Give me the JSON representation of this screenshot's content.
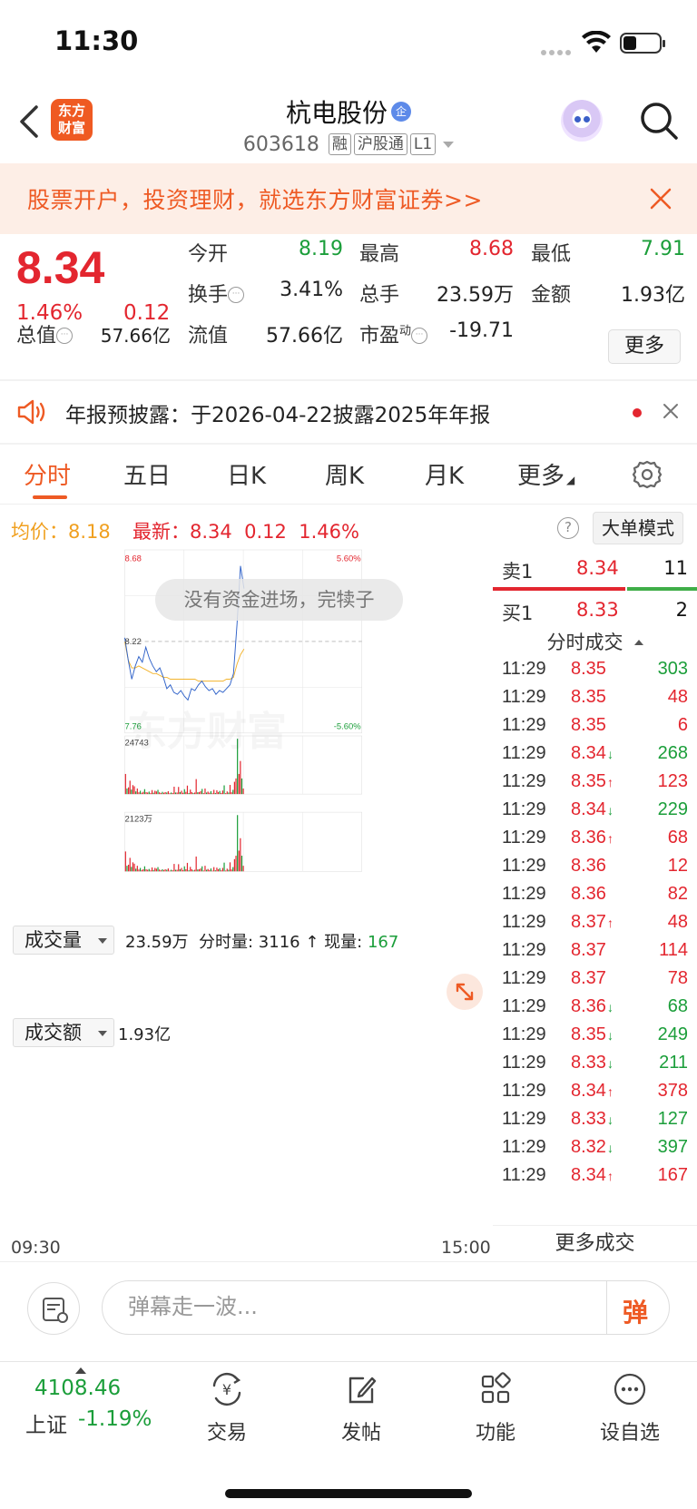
{
  "status_bar": {
    "time": "11:30"
  },
  "header": {
    "logo_text_1": "东方",
    "logo_text_2": "财富",
    "stock_name": "杭电股份",
    "enterprise_badge": "企",
    "stock_code": "603618",
    "tags": [
      "融",
      "沪股通",
      "L1"
    ]
  },
  "ad_banner": {
    "text": "股票开户，投资理财，就选东方财富证券>>"
  },
  "quote": {
    "last_price": "8.34",
    "change_pct": "1.46%",
    "change_amt": "0.12",
    "fields": [
      {
        "label": "今开",
        "value": "8.19",
        "color": "#1b9e3a"
      },
      {
        "label": "最高",
        "value": "8.68",
        "color": "#e3262f"
      },
      {
        "label": "最低",
        "value": "7.91",
        "color": "#1b9e3a"
      },
      {
        "label": "换手",
        "value": "3.41%",
        "color": "#222222"
      },
      {
        "label": "总手",
        "value": "23.59万",
        "color": "#222222"
      },
      {
        "label": "金额",
        "value": "1.93亿",
        "color": "#222222"
      },
      {
        "label": "总值",
        "value": "57.66亿",
        "color": "#222222"
      },
      {
        "label": "流值",
        "value": "57.66亿",
        "color": "#222222"
      },
      {
        "label": "市盈",
        "sup": "动",
        "value": "-19.71",
        "color": "#222222"
      }
    ],
    "more_label": "更多"
  },
  "notice": {
    "text": "年报预披露：于2026-04-22披露2025年年报"
  },
  "tabs": [
    {
      "label": "分时",
      "active": true
    },
    {
      "label": "五日"
    },
    {
      "label": "日K"
    },
    {
      "label": "周K"
    },
    {
      "label": "月K"
    },
    {
      "label": "更多"
    }
  ],
  "chart_header": {
    "avg_label": "均价：8.18",
    "latest_label": "最新：8.34",
    "latest_change": "0.12",
    "latest_pct": "1.46%",
    "big_order_mode": "大单模式",
    "help": "?"
  },
  "chart_data": [
    {
      "type": "line",
      "y_axis_left": {
        "top": "8.68",
        "mid": "8.22",
        "bottom": "7.76"
      },
      "y_axis_right": {
        "top": "5.60%",
        "bottom": "-5.60%"
      },
      "ylim": [
        7.76,
        8.68
      ],
      "prev_close": 8.22,
      "x_start": "09:30",
      "x_end": "15:00",
      "series": [
        {
          "values": [
            8.24,
            8.12,
            8.02,
            8.09,
            8.14,
            8.11,
            8.19,
            8.13,
            8.09,
            8.06,
            8.08,
            8.03,
            7.97,
            7.99,
            7.95,
            7.94,
            7.96,
            7.93,
            7.91,
            7.97,
            7.96,
            7.99,
            8.01,
            7.98,
            7.96,
            7.97,
            7.94,
            7.96,
            7.95,
            7.97,
            7.99,
            8.05,
            8.31,
            8.62,
            8.5
          ]
        },
        {
          "values": [
            8.22,
            8.12,
            8.08,
            8.08,
            8.09,
            8.08,
            8.07,
            8.06,
            8.05,
            8.05,
            8.04,
            8.03,
            8.03,
            8.02,
            8.02,
            8.02,
            8.02,
            8.02,
            8.02,
            8.02,
            8.02,
            8.01,
            8.01,
            8.01,
            8.01,
            8.01,
            8.01,
            8.01,
            8.01,
            8.02,
            8.02,
            8.03,
            8.1,
            8.15,
            8.18
          ]
        }
      ],
      "colors": {
        "price": "#2f62c9",
        "avg": "#f2b32c",
        "axis_up": "#e3262f",
        "axis_down": "#1b9e3a"
      }
    },
    {
      "type": "bar",
      "ylabel_max": "24743",
      "values": [
        9000,
        2500,
        3000,
        6000,
        2000,
        4000,
        3500,
        1200,
        2500,
        800,
        1500,
        600,
        1000,
        2200,
        900,
        700,
        1100,
        500,
        1800,
        600,
        1500,
        1200,
        1900,
        800,
        500,
        1000,
        600,
        900,
        700,
        1300,
        400,
        700,
        500,
        3300,
        700,
        700,
        3200,
        900,
        1500,
        600,
        2200,
        1000,
        3800,
        500,
        2000,
        900,
        500,
        700,
        6700,
        800,
        900,
        1300,
        2300,
        400,
        2500,
        700,
        1100,
        600,
        1300,
        400,
        1900,
        500,
        1700,
        900,
        1400,
        500,
        1600,
        3900,
        400,
        1200,
        700,
        4100,
        800,
        1900,
        5500,
        7000,
        24743,
        9000,
        14800,
        7000,
        2500
      ],
      "up_color": "#e3262f",
      "down_color": "#1b9e3a"
    },
    {
      "type": "bar",
      "ylabel_max": "2123万",
      "values": [
        750,
        210,
        250,
        510,
        170,
        340,
        290,
        100,
        210,
        70,
        130,
        50,
        80,
        190,
        80,
        60,
        90,
        40,
        150,
        50,
        130,
        100,
        160,
        70,
        40,
        80,
        50,
        80,
        60,
        110,
        30,
        60,
        40,
        280,
        60,
        60,
        270,
        80,
        130,
        50,
        190,
        80,
        320,
        40,
        170,
        80,
        40,
        60,
        560,
        70,
        80,
        110,
        190,
        30,
        210,
        60,
        90,
        50,
        110,
        30,
        160,
        40,
        140,
        80,
        120,
        40,
        130,
        330,
        30,
        100,
        60,
        340,
        70,
        160,
        460,
        590,
        2123,
        780,
        1250,
        590,
        210
      ],
      "up_color": "#e3262f",
      "down_color": "#1b9e3a"
    }
  ],
  "chart_overlay": {
    "toast": "没有资金进场，完犊子",
    "watermark": "东方财富"
  },
  "volume_section": {
    "dropdown": "成交量",
    "total": "23.59万",
    "tick_label": "分时量:",
    "tick_value": "3116",
    "tick_arrow": "↑",
    "cur_label": "现量:",
    "cur_value": "167"
  },
  "amount_section": {
    "dropdown": "成交额",
    "total": "1.93亿"
  },
  "order_book": {
    "ask": {
      "label": "卖1",
      "price": "8.34",
      "volume": "11"
    },
    "bid": {
      "label": "买1",
      "price": "8.33",
      "volume": "2"
    },
    "ticks_title": "分时成交",
    "ticks": [
      {
        "time": "11:29",
        "price": "8.35",
        "arrow": "",
        "volume": "303",
        "pc": "#e3262f",
        "vc": "#1b9e3a"
      },
      {
        "time": "11:29",
        "price": "8.35",
        "arrow": "",
        "volume": "48",
        "pc": "#e3262f",
        "vc": "#e3262f"
      },
      {
        "time": "11:29",
        "price": "8.35",
        "arrow": "",
        "volume": "6",
        "pc": "#e3262f",
        "vc": "#e3262f"
      },
      {
        "time": "11:29",
        "price": "8.34",
        "arrow": "↓",
        "volume": "268",
        "pc": "#e3262f",
        "vc": "#1b9e3a"
      },
      {
        "time": "11:29",
        "price": "8.35",
        "arrow": "↑",
        "volume": "123",
        "pc": "#e3262f",
        "vc": "#e3262f"
      },
      {
        "time": "11:29",
        "price": "8.34",
        "arrow": "↓",
        "volume": "229",
        "pc": "#e3262f",
        "vc": "#1b9e3a"
      },
      {
        "time": "11:29",
        "price": "8.36",
        "arrow": "↑",
        "volume": "68",
        "pc": "#e3262f",
        "vc": "#e3262f"
      },
      {
        "time": "11:29",
        "price": "8.36",
        "arrow": "",
        "volume": "12",
        "pc": "#e3262f",
        "vc": "#e3262f"
      },
      {
        "time": "11:29",
        "price": "8.36",
        "arrow": "",
        "volume": "82",
        "pc": "#e3262f",
        "vc": "#e3262f"
      },
      {
        "time": "11:29",
        "price": "8.37",
        "arrow": "↑",
        "volume": "48",
        "pc": "#e3262f",
        "vc": "#e3262f"
      },
      {
        "time": "11:29",
        "price": "8.37",
        "arrow": "",
        "volume": "114",
        "pc": "#e3262f",
        "vc": "#e3262f"
      },
      {
        "time": "11:29",
        "price": "8.37",
        "arrow": "",
        "volume": "78",
        "pc": "#e3262f",
        "vc": "#e3262f"
      },
      {
        "time": "11:29",
        "price": "8.36",
        "arrow": "↓",
        "volume": "68",
        "pc": "#e3262f",
        "vc": "#1b9e3a"
      },
      {
        "time": "11:29",
        "price": "8.35",
        "arrow": "↓",
        "volume": "249",
        "pc": "#e3262f",
        "vc": "#1b9e3a"
      },
      {
        "time": "11:29",
        "price": "8.33",
        "arrow": "↓",
        "volume": "211",
        "pc": "#e3262f",
        "vc": "#1b9e3a"
      },
      {
        "time": "11:29",
        "price": "8.34",
        "arrow": "↑",
        "volume": "378",
        "pc": "#e3262f",
        "vc": "#e3262f"
      },
      {
        "time": "11:29",
        "price": "8.33",
        "arrow": "↓",
        "volume": "127",
        "pc": "#e3262f",
        "vc": "#1b9e3a"
      },
      {
        "time": "11:29",
        "price": "8.32",
        "arrow": "↓",
        "volume": "397",
        "pc": "#e3262f",
        "vc": "#1b9e3a"
      },
      {
        "time": "11:29",
        "price": "8.34",
        "arrow": "↑",
        "volume": "167",
        "pc": "#e3262f",
        "vc": "#e3262f"
      }
    ],
    "more_ticks": "更多成交"
  },
  "comment_bar": {
    "placeholder": "弹幕走一波...",
    "danmaku_icon": "弹"
  },
  "bottom_nav": {
    "index_value": "4108.46",
    "index_name": "上证",
    "index_pct": "-1.19%",
    "items": [
      {
        "label": "交易",
        "icon": "yen-cycle-icon"
      },
      {
        "label": "发帖",
        "icon": "edit-icon"
      },
      {
        "label": "功能",
        "icon": "grid-icon"
      },
      {
        "label": "设自选",
        "icon": "more-icon"
      }
    ]
  }
}
